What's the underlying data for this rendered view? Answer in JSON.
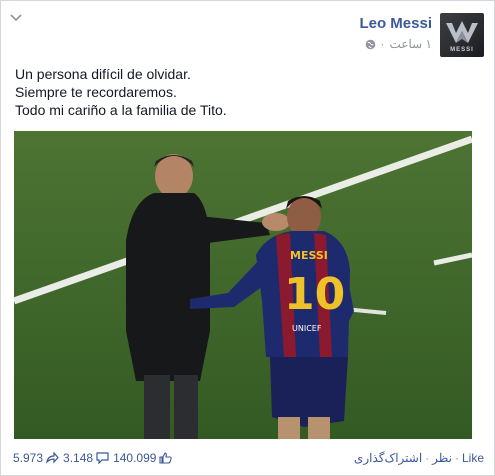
{
  "post": {
    "author": "Leo Messi",
    "timestamp": "۱ ساعت",
    "lines": [
      "Un persona difícil de olvidar.",
      "Siempre te recordaremos.",
      "Todo mi cariño a la familia de Tito."
    ],
    "avatar_brand": "MESSI",
    "jersey_name": "MESSI",
    "jersey_number": "10",
    "jersey_sponsor": "UNICEF"
  },
  "footer": {
    "likes": "140.099",
    "comments": "3.148",
    "shares": "5.973",
    "like_label": "Like",
    "comment_label": "نظر",
    "share_label": "اشتراک‌گذاری"
  },
  "icons": {
    "globe": "globe-icon",
    "chevron": "chevron-down-icon",
    "like": "thumbs-up-icon",
    "comment": "comment-bubble-icon",
    "share": "share-arrow-icon"
  },
  "colors": {
    "link": "#3b5998",
    "meta": "#90949c",
    "text": "#141823",
    "pitch": "#3f6a2c"
  }
}
